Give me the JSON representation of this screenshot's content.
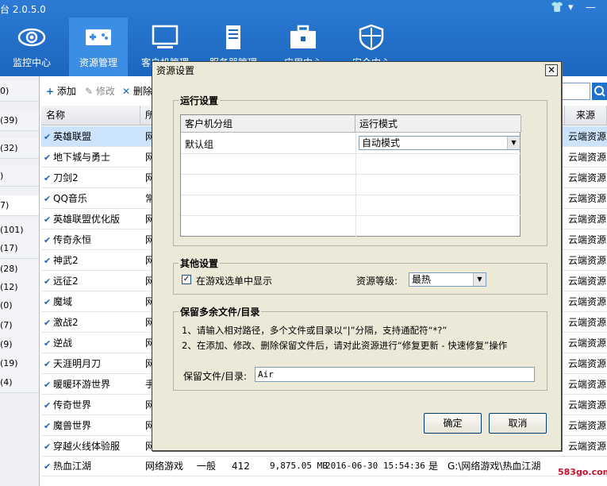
{
  "app": {
    "title": "台 2.0.5.0"
  },
  "window_controls": [
    "👕",
    "▾",
    "—"
  ],
  "nav": [
    {
      "label": "监控中心",
      "icon": "eye-icon"
    },
    {
      "label": "资源管理",
      "icon": "gamepad-icon"
    },
    {
      "label": "客户机管理",
      "icon": "monitor-icon"
    },
    {
      "label": "服务器管理",
      "icon": "server-icon"
    },
    {
      "label": "应用中心",
      "icon": "toolbox-icon"
    },
    {
      "label": "安全中心",
      "icon": "shield-icon"
    }
  ],
  "left_groups": [
    "0)",
    "(39)",
    "(32)",
    ")",
    "7)",
    "(101)",
    "(17)",
    "(28)",
    "(12)",
    "(0)",
    "(7)",
    "(9)",
    "(19)",
    "(4)"
  ],
  "toolbar": {
    "add": "添加",
    "edit": "修改",
    "delete": "删除"
  },
  "grid": {
    "headers": {
      "name": "名称",
      "cat": "所",
      "source": "来源"
    },
    "rows": [
      {
        "name": "英雄联盟",
        "cat": "网",
        "source": "云端资源"
      },
      {
        "name": "地下城与勇士",
        "cat": "网",
        "source": "云端资源"
      },
      {
        "name": "刀剑2",
        "cat": "网",
        "source": "云端资源"
      },
      {
        "name": "QQ音乐",
        "cat": "常",
        "source": "云端资源"
      },
      {
        "name": "英雄联盟优化版",
        "cat": "网",
        "source": "云端资源"
      },
      {
        "name": "传奇永恒",
        "cat": "网",
        "source": "云端资源"
      },
      {
        "name": "神武2",
        "cat": "网",
        "source": "云端资源"
      },
      {
        "name": "远征2",
        "cat": "网",
        "source": "云端资源"
      },
      {
        "name": "魔域",
        "cat": "网",
        "source": "云端资源"
      },
      {
        "name": "激战2",
        "cat": "网",
        "source": "云端资源"
      },
      {
        "name": "逆战",
        "cat": "网",
        "source": "云端资源"
      },
      {
        "name": "天涯明月刀",
        "cat": "网",
        "source": "云端资源"
      },
      {
        "name": "暖暖环游世界",
        "cat": "手",
        "source": "云端资源"
      },
      {
        "name": "传奇世界",
        "cat": "网",
        "source": "云端资源"
      },
      {
        "name": "魔兽世界",
        "cat": "网",
        "source": "云端资源"
      },
      {
        "name": "穿越火线体验服",
        "cat": "网",
        "source": "云端资源"
      }
    ],
    "last_row": {
      "name": "热血江湖",
      "cat": "网络游戏",
      "level": "一般",
      "num": "412",
      "size": "9,875.05 MB",
      "date": "2016-06-30 15:54:36",
      "yes": "是",
      "path": "G:\\网络游戏\\热血江湖"
    }
  },
  "dialog": {
    "title": "资源设置",
    "close": "✕",
    "run_settings": {
      "legend": "运行设置",
      "col_group": "客户机分组",
      "col_mode": "运行模式",
      "row_group": "默认组",
      "row_mode": "自动模式"
    },
    "other_settings": {
      "legend": "其他设置",
      "show_in_menu": "在游戏选单中显示",
      "level_label": "资源等级:",
      "level_value": "最热"
    },
    "keep_files": {
      "legend": "保留多余文件/目录",
      "tip1": "1、请输入相对路径，多个文件或目录以“|”分隔，支持通配符“*?”",
      "tip2": "2、在添加、修改、删除保留文件后，请对此资源进行“修复更新 - 快速修复”操作",
      "field_label": "保留文件/目录:",
      "field_value": "Air"
    },
    "ok": "确定",
    "cancel": "取消"
  },
  "watermark": "583go.com"
}
